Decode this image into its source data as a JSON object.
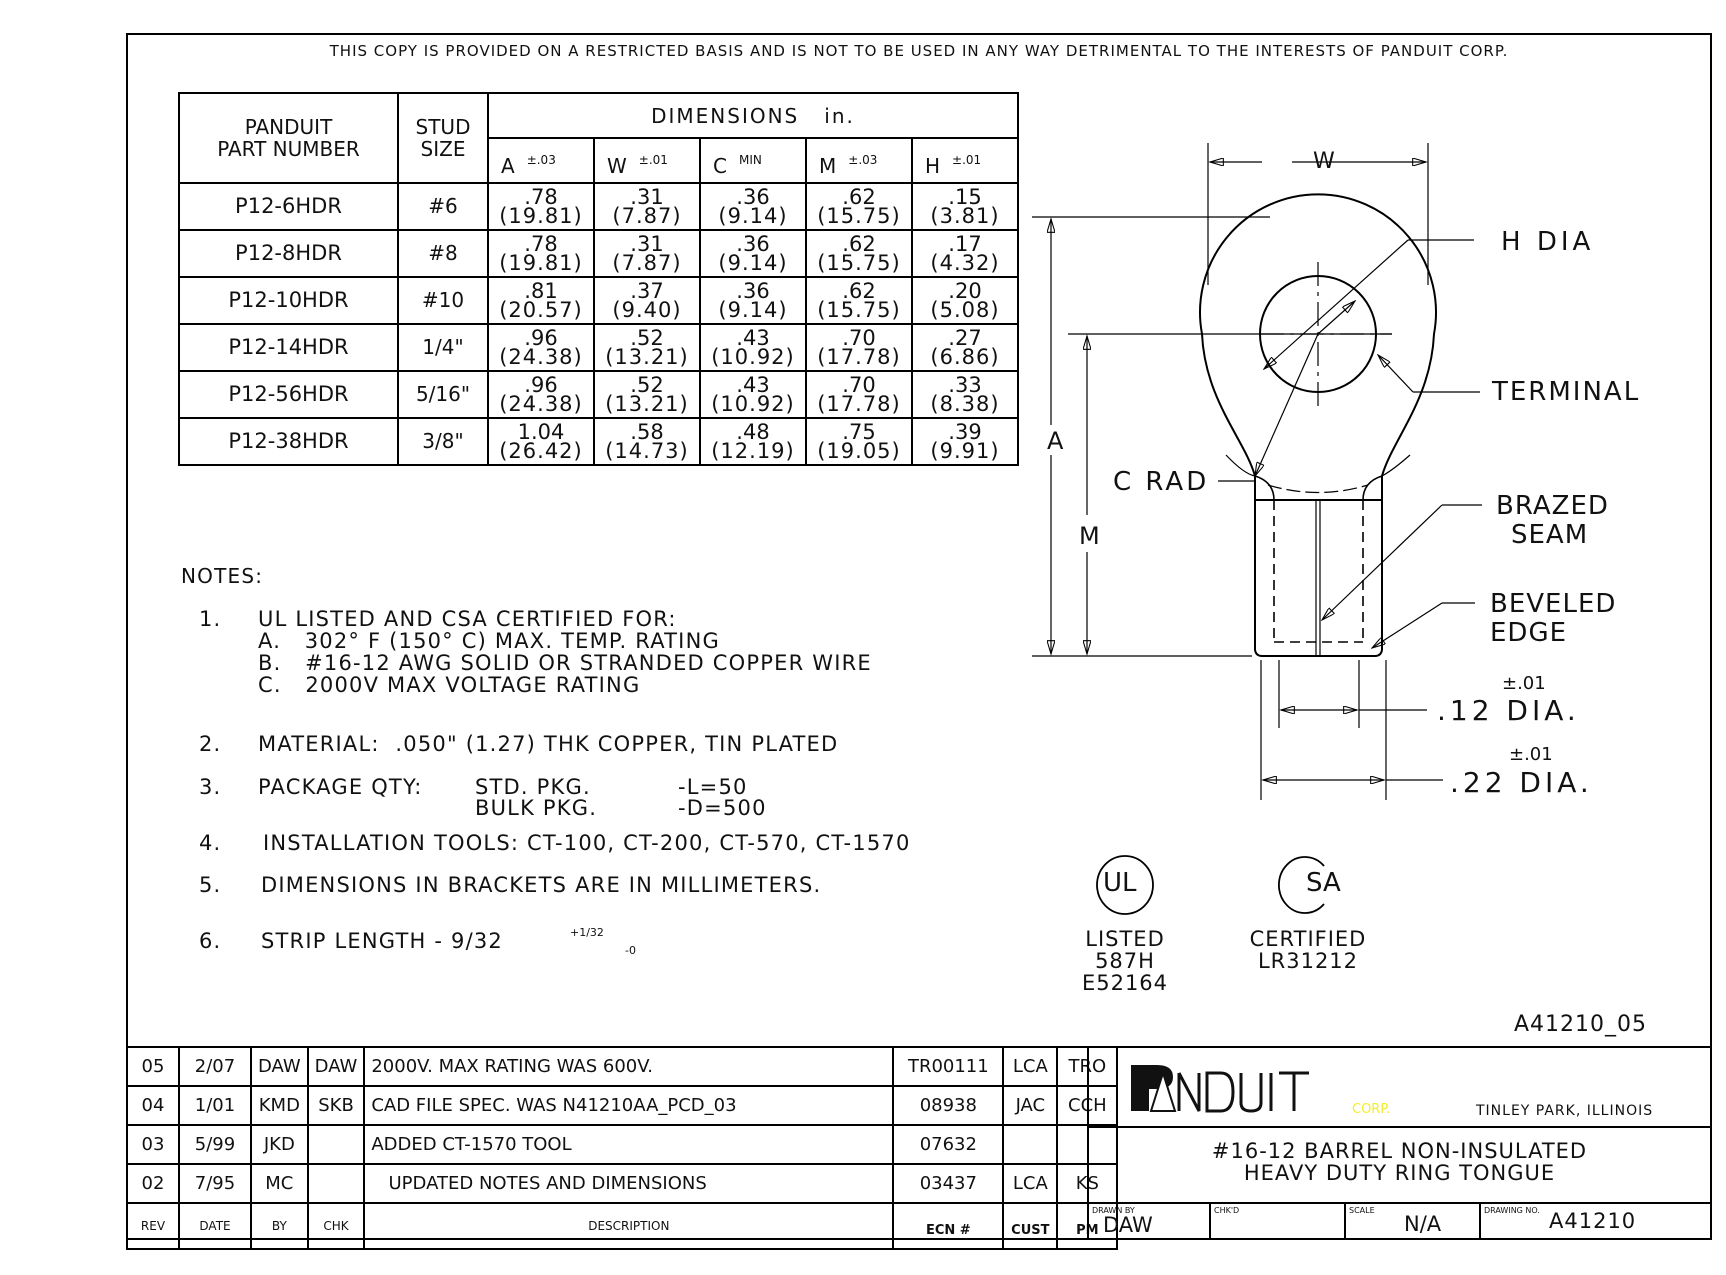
{
  "notice": "THIS COPY IS PROVIDED ON A RESTRICTED BASIS AND IS NOT TO BE USED IN ANY WAY DETRIMENTAL TO THE INTERESTS OF PANDUIT CORP.",
  "dimension_table": {
    "header_part": [
      "PANDUIT",
      "PART NUMBER"
    ],
    "header_stud": [
      "STUD",
      "SIZE"
    ],
    "header_dimensions": "DIMENSIONS   in.",
    "columns": [
      {
        "label": "A",
        "tol": "±.03"
      },
      {
        "label": "W",
        "tol": "±.01"
      },
      {
        "label": "C",
        "tol": "MIN"
      },
      {
        "label": "M",
        "tol": "±.03"
      },
      {
        "label": "H",
        "tol": "±.01"
      }
    ],
    "rows": [
      {
        "part": "P12-6HDR",
        "stud": "#6",
        "values": [
          [
            ".78",
            "(19.81)"
          ],
          [
            ".31",
            "(7.87)"
          ],
          [
            ".36",
            "(9.14)"
          ],
          [
            ".62",
            "(15.75)"
          ],
          [
            ".15",
            "(3.81)"
          ]
        ]
      },
      {
        "part": "P12-8HDR",
        "stud": "#8",
        "values": [
          [
            ".78",
            "(19.81)"
          ],
          [
            ".31",
            "(7.87)"
          ],
          [
            ".36",
            "(9.14)"
          ],
          [
            ".62",
            "(15.75)"
          ],
          [
            ".17",
            "(4.32)"
          ]
        ]
      },
      {
        "part": "P12-10HDR",
        "stud": "#10",
        "values": [
          [
            ".81",
            "(20.57)"
          ],
          [
            ".37",
            "(9.40)"
          ],
          [
            ".36",
            "(9.14)"
          ],
          [
            ".62",
            "(15.75)"
          ],
          [
            ".20",
            "(5.08)"
          ]
        ]
      },
      {
        "part": "P12-14HDR",
        "stud": "1/4\"",
        "values": [
          [
            ".96",
            "(24.38)"
          ],
          [
            ".52",
            "(13.21)"
          ],
          [
            ".43",
            "(10.92)"
          ],
          [
            ".70",
            "(17.78)"
          ],
          [
            ".27",
            "(6.86)"
          ]
        ]
      },
      {
        "part": "P12-56HDR",
        "stud": "5/16\"",
        "values": [
          [
            ".96",
            "(24.38)"
          ],
          [
            ".52",
            "(13.21)"
          ],
          [
            ".43",
            "(10.92)"
          ],
          [
            ".70",
            "(17.78)"
          ],
          [
            ".33",
            "(8.38)"
          ]
        ]
      },
      {
        "part": "P12-38HDR",
        "stud": "3/8\"",
        "values": [
          [
            "1.04",
            "(26.42)"
          ],
          [
            ".58",
            "(14.73)"
          ],
          [
            ".48",
            "(12.19)"
          ],
          [
            ".75",
            "(19.05)"
          ],
          [
            ".39",
            "(9.91)"
          ]
        ]
      }
    ]
  },
  "notes": {
    "title": "NOTES:",
    "n1": {
      "num": "1.",
      "text": "UL LISTED AND CSA CERTIFIED FOR:",
      "a": "A.   302° F (150° C) MAX. TEMP. RATING",
      "b": "B.   #16-12 AWG SOLID OR STRANDED COPPER WIRE",
      "c": "C.   2000V MAX VOLTAGE RATING"
    },
    "n2": {
      "num": "2.",
      "text": "MATERIAL:  .050\" (1.27) THK COPPER, TIN PLATED"
    },
    "n3": {
      "num": "3.",
      "text": "PACKAGE QTY:",
      "std_label": "STD. PKG.",
      "std_value": "-L=50",
      "bulk_label": "BULK PKG.",
      "bulk_value": "-D=500"
    },
    "n4": {
      "num": "4.",
      "text": "INSTALLATION TOOLS: CT-100, CT-200, CT-570, CT-1570"
    },
    "n5": {
      "num": "5.",
      "text": "DIMENSIONS IN BRACKETS ARE IN MILLIMETERS."
    },
    "n6": {
      "num": "6.",
      "text": "STRIP LENGTH - 9/32",
      "tol_plus": "+1/32",
      "tol_minus": "-0"
    }
  },
  "drawing": {
    "labels": {
      "w": "W",
      "h_dia": "H DIA",
      "terminal": "TERMINAL",
      "a": "A",
      "c_rad": "C RAD",
      "m": "M",
      "brazed": "BRAZED",
      "seam": "SEAM",
      "beveled": "BEVELED",
      "edge": "EDGE",
      "tol1": "±.01",
      "dia1": ".12 DIA.",
      "tol2": "±.01",
      "dia2": ".22 DIA."
    }
  },
  "certifications": {
    "ul_symbol": "UL",
    "ul_lines": [
      "LISTED",
      "587H",
      "E52164"
    ],
    "csa_symbol": "SA",
    "csa_lines": [
      "CERTIFIED",
      "LR31212"
    ]
  },
  "drawing_ref": "A41210_05",
  "revisions": [
    {
      "rev": "05",
      "date": "2/07",
      "by": "DAW",
      "chk": "DAW",
      "desc": "2000V. MAX RATING WAS 600V.",
      "ecn": "TR00111",
      "cust": "LCA",
      "pm": "TRO"
    },
    {
      "rev": "04",
      "date": "1/01",
      "by": "KMD",
      "chk": "SKB",
      "desc": "CAD FILE SPEC. WAS N41210AA_PCD_03",
      "ecn": "08938",
      "cust": "JAC",
      "pm": "CCH"
    },
    {
      "rev": "03",
      "date": "5/99",
      "by": "JKD",
      "chk": "",
      "desc": "ADDED CT-1570 TOOL",
      "ecn": "07632",
      "cust": "",
      "pm": ""
    },
    {
      "rev": "02",
      "date": "7/95",
      "by": "MC",
      "chk": "",
      "desc": "   UPDATED NOTES AND DIMENSIONS",
      "ecn": "03437",
      "cust": "LCA",
      "pm": "KS"
    }
  ],
  "revision_headers": {
    "rev": "REV",
    "date": "DATE",
    "by": "BY",
    "chk": "CHK",
    "desc": "DESCRIPTION",
    "ecn": "ECN #",
    "cust": "CUST",
    "pm": "PM"
  },
  "title_block": {
    "logo_text": "PANDUIT",
    "corp": "CORP.",
    "corp_color": "#f2ee30",
    "location": "TINLEY PARK, ILLINOIS",
    "title_line1": "#16-12 BARREL NON-INSULATED",
    "title_line2": "HEAVY DUTY RING TONGUE",
    "drawn_by_label": "DRAWN BY",
    "drawn_by": "DAW",
    "chkd_label": "CHK'D",
    "chkd": "",
    "scale_label": "SCALE",
    "scale": "N/A",
    "drawing_no_label": "DRAWING NO.",
    "drawing_no": "A41210"
  }
}
